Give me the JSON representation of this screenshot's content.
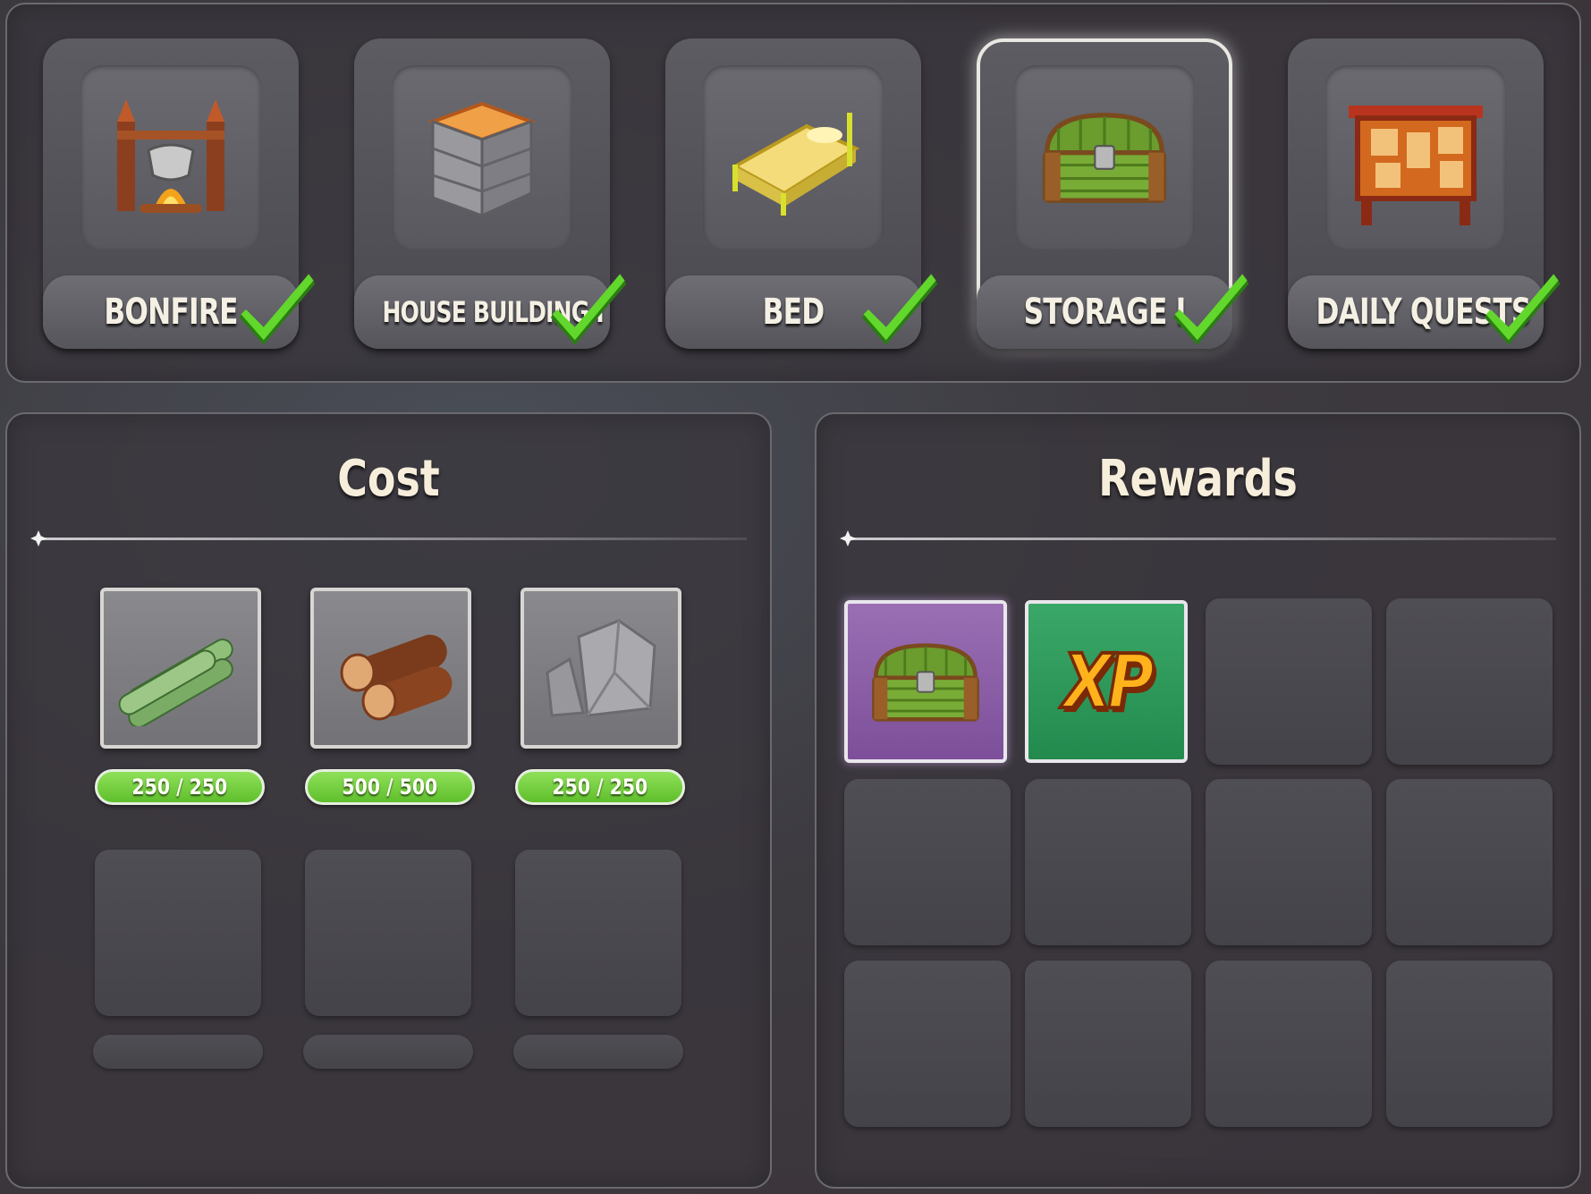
{
  "quests": [
    {
      "label": "BONFIRE",
      "icon": "bonfire-icon",
      "completed": true,
      "selected": false
    },
    {
      "label": "HOUSE BUILDING I",
      "icon": "house-building-icon",
      "completed": true,
      "selected": false
    },
    {
      "label": "BED",
      "icon": "bed-icon",
      "completed": true,
      "selected": false
    },
    {
      "label": "STORAGE I",
      "icon": "storage-chest-icon",
      "completed": true,
      "selected": true
    },
    {
      "label": "DAILY QUESTS",
      "icon": "quest-board-icon",
      "completed": true,
      "selected": false
    }
  ],
  "cost": {
    "title": "Cost",
    "items": [
      {
        "icon": "bamboo-icon",
        "amount": "250 / 250"
      },
      {
        "icon": "wood-logs-icon",
        "amount": "500 / 500"
      },
      {
        "icon": "stone-icon",
        "amount": "250 / 250"
      }
    ]
  },
  "rewards": {
    "title": "Rewards",
    "items": [
      {
        "icon": "storage-chest-icon",
        "rarity_color": "#8b5fa8"
      },
      {
        "icon": "xp-icon",
        "text": "XP",
        "rarity_color": "#2e9a5c"
      }
    ]
  },
  "colors": {
    "progress_green": "#6fcf3a",
    "check_green": "#5bd62a",
    "selected_border": "#e9e7e2"
  }
}
